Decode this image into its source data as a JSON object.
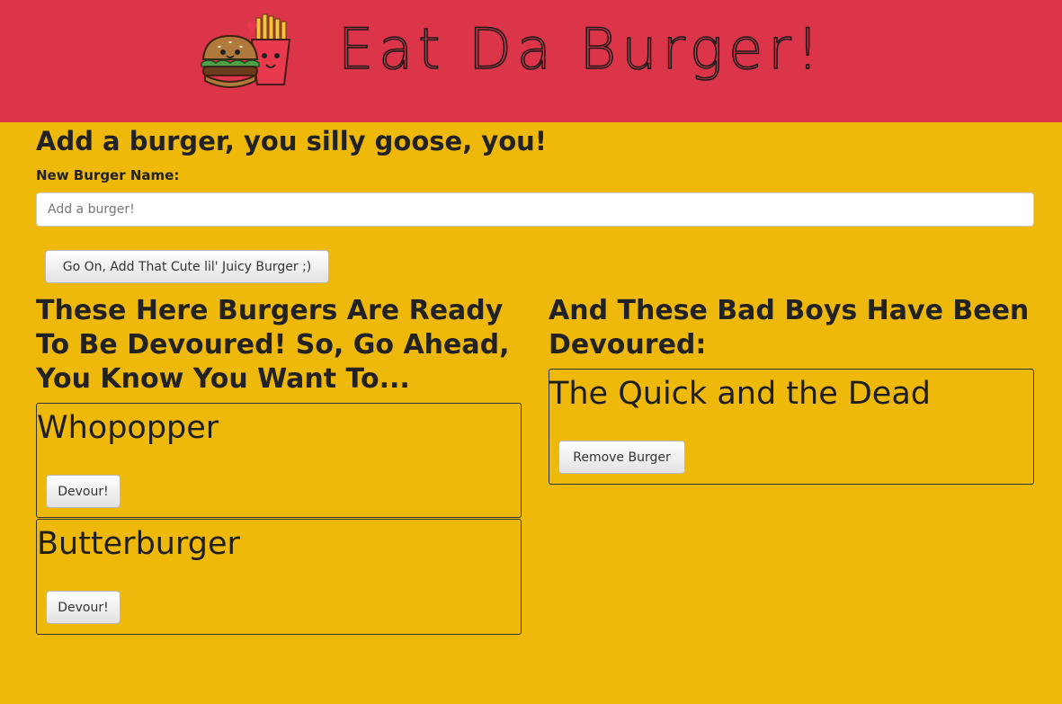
{
  "header": {
    "title": "Eat Da Burger!",
    "logo": "burger-and-fries-logo",
    "background_color": "#dc3449"
  },
  "page": {
    "background_color": "#efb90c"
  },
  "form": {
    "heading": "Add a burger, you silly goose, you!",
    "label": "New Burger Name:",
    "input_value": "",
    "input_placeholder": "Add a burger!",
    "submit_label": "Go On, Add That Cute lil' Juicy Burger ;)"
  },
  "ready": {
    "heading": "These Here Burgers Are Ready To Be Devoured! So, Go Ahead, You Know You Want To...",
    "burgers": [
      {
        "name": "Whopopper",
        "button_label": "Devour!"
      },
      {
        "name": "Butterburger",
        "button_label": "Devour!"
      }
    ]
  },
  "devoured": {
    "heading": "And These Bad Boys Have Been Devoured:",
    "burgers": [
      {
        "name": "The Quick and the Dead",
        "button_label": "Remove Burger"
      }
    ]
  }
}
